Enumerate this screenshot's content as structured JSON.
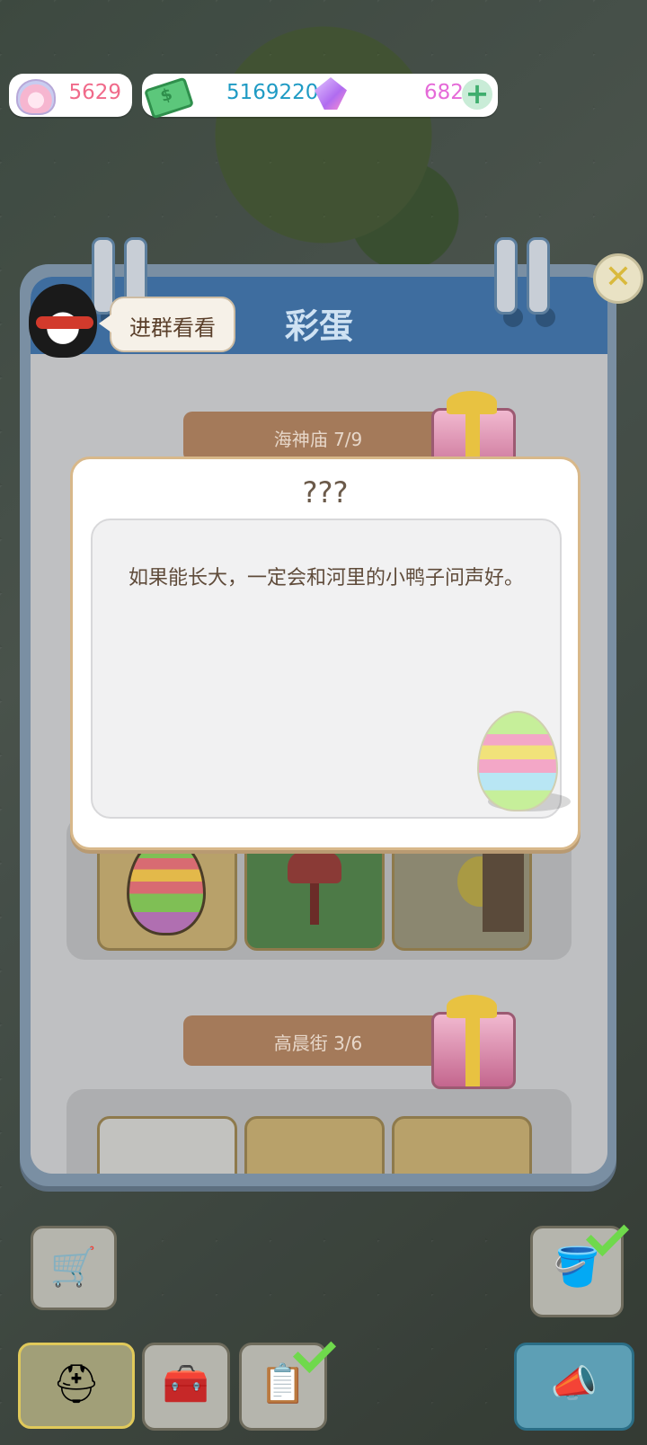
{
  "currency": {
    "shells": "5629",
    "money": "5169220",
    "gems": "682"
  },
  "panel": {
    "title": "彩蛋",
    "speech_bubble": "进群看看",
    "sections": [
      {
        "label": "海神庙 7/9"
      },
      {
        "label": "高晨街 3/6"
      }
    ]
  },
  "modal": {
    "title": "???",
    "text": "如果能长大，一定会和河里的小鸭子问声好。"
  },
  "icons": {
    "shell": "shell-icon",
    "money": "money-icon",
    "gem": "gem-icon",
    "plus": "plus-icon",
    "close": "close-icon",
    "gift": "gift-icon",
    "egg": "egg-icon",
    "cart": "cart-icon",
    "hat": "hard-hat-icon",
    "toolbox": "toolbox-icon",
    "clipboard": "clipboard-icon",
    "bucket": "bucket-icon",
    "megaphone": "megaphone-icon",
    "check": "check-icon"
  },
  "colors": {
    "panel_header": "#3e6d9f",
    "section_bar": "#a47a5a",
    "modal_border": "#d8b88a",
    "money_text": "#1f9bc4",
    "shell_text": "#f06a8a",
    "gem_text": "#e56ad8"
  }
}
